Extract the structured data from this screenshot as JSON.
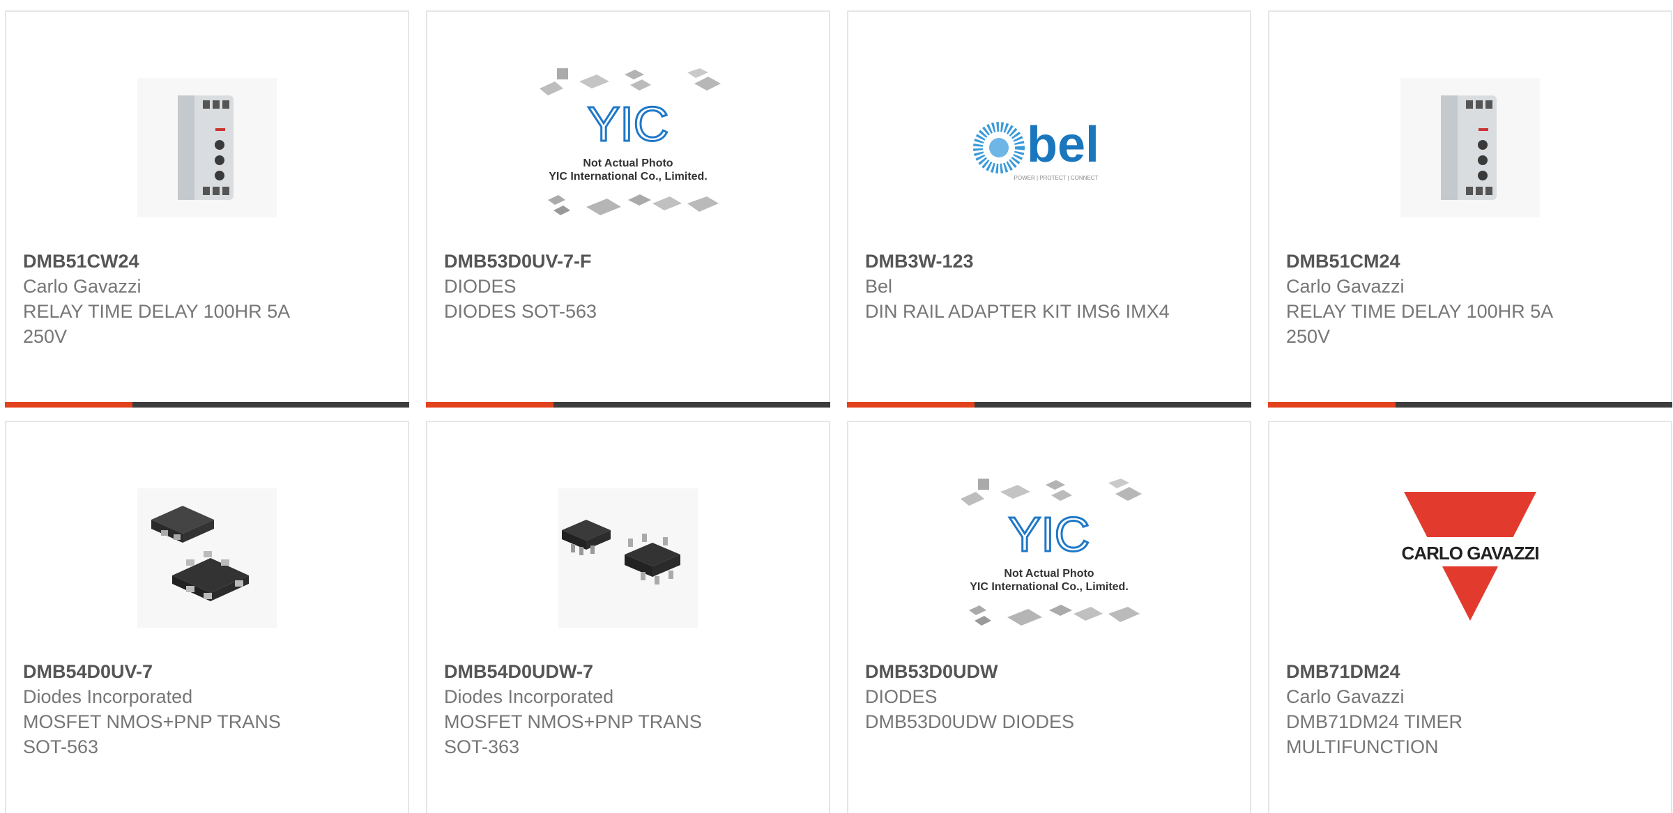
{
  "products": [
    {
      "part_number": "DMB51CW24",
      "manufacturer": "Carlo Gavazzi",
      "description": "RELAY TIME DELAY 100HR 5A 250V",
      "image": "din-rail-relay-module"
    },
    {
      "part_number": "DMB53D0UV-7-F",
      "manufacturer": "DIODES",
      "description": "DIODES SOT-563",
      "image": "yic-placeholder",
      "image_text": {
        "logo": "YIC",
        "line1": "Not Actual Photo",
        "line2": "YIC International Co., Limited."
      }
    },
    {
      "part_number": "DMB3W-123",
      "manufacturer": "Bel",
      "description": "DIN RAIL ADAPTER KIT IMS6 IMX4",
      "image": "bel-logo",
      "image_text": {
        "logo": "bel",
        "tagline": "POWER | PROTECT | CONNECT"
      }
    },
    {
      "part_number": "DMB51CM24",
      "manufacturer": "Carlo Gavazzi",
      "description": "RELAY TIME DELAY 100HR 5A 250V",
      "image": "din-rail-relay-module"
    },
    {
      "part_number": "DMB54D0UV-7",
      "manufacturer": "Diodes Incorporated",
      "description": "MOSFET NMOS+PNP TRANS SOT-563",
      "image": "sot-563-package"
    },
    {
      "part_number": "DMB54D0UDW-7",
      "manufacturer": "Diodes Incorporated",
      "description": "MOSFET NMOS+PNP TRANS SOT-363",
      "image": "sot-363-package"
    },
    {
      "part_number": "DMB53D0UDW",
      "manufacturer": "DIODES",
      "description": "DMB53D0UDW DIODES",
      "image": "yic-placeholder",
      "image_text": {
        "logo": "YIC",
        "line1": "Not Actual Photo",
        "line2": "YIC International Co., Limited."
      }
    },
    {
      "part_number": "DMB71DM24",
      "manufacturer": "Carlo Gavazzi",
      "description": "DMB71DM24 TIMER MULTIFUNCTION",
      "image": "carlo-gavazzi-logo",
      "image_text": {
        "logo": "CARLO GAVAZZI"
      }
    }
  ],
  "colors": {
    "accent": "#e2431e",
    "bar": "#3d3d3d",
    "text": "#767676",
    "part_number": "#555555",
    "yic_blue": "#1f78c8",
    "bel_blue": "#1a76bd",
    "gavazzi_red": "#e23b2e"
  }
}
